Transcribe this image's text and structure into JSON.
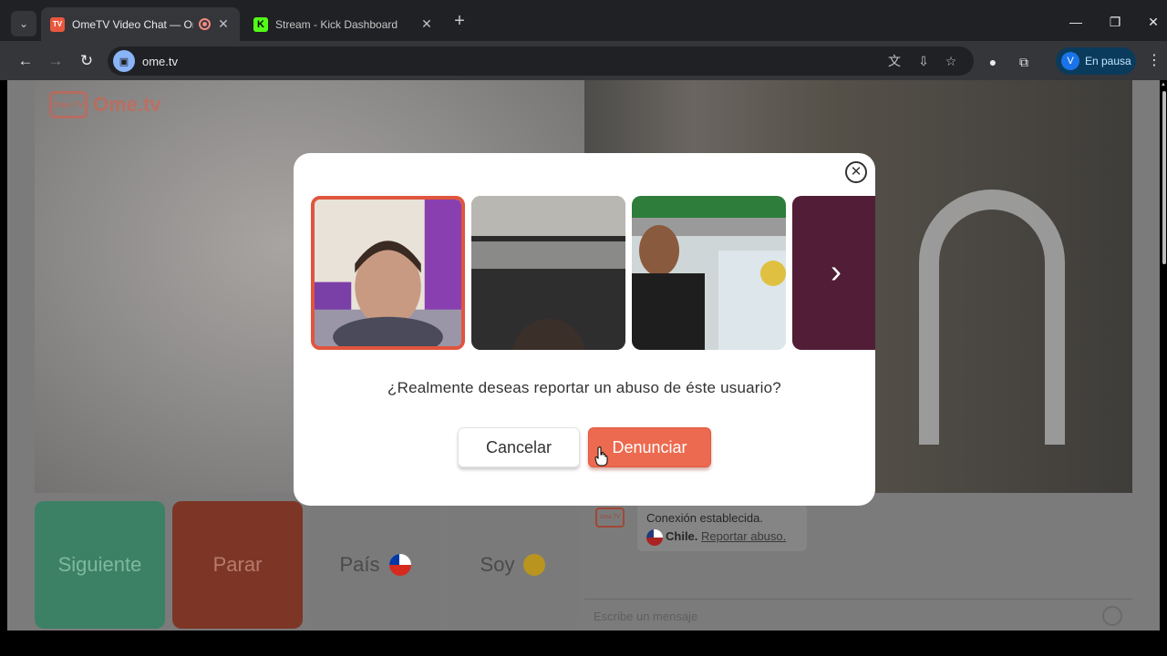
{
  "browser": {
    "tabs": [
      {
        "title": "OmeTV Video Chat — Ome",
        "favicon": "ometv-icon",
        "active": true,
        "recording": true
      },
      {
        "title": "Stream - Kick Dashboard",
        "favicon": "kick-icon",
        "active": false
      }
    ],
    "url": "ome.tv",
    "profile_initial": "V",
    "profile_label": "En pausa"
  },
  "page": {
    "logo_box": "Ome TV",
    "logo_word": "Ome.tv",
    "controls": {
      "next": "Siguiente",
      "stop": "Parar",
      "country": "País",
      "me": "Soy"
    },
    "chat": {
      "status": "Conexión establecida.",
      "country": "Chile.",
      "report_link": "Reportar abuso.",
      "input_placeholder": "Escribe un mensaje"
    }
  },
  "modal": {
    "question": "¿Realmente deseas reportar un abuso de éste usuario?",
    "cancel_label": "Cancelar",
    "report_label": "Denunciar",
    "selected_thumbnail_index": 0,
    "thumbnail_count": 4
  },
  "colors": {
    "accent": "#ec6a4f",
    "next_green": "#3c8165",
    "stop_red": "#7d3626",
    "brand": "#e9573f"
  }
}
